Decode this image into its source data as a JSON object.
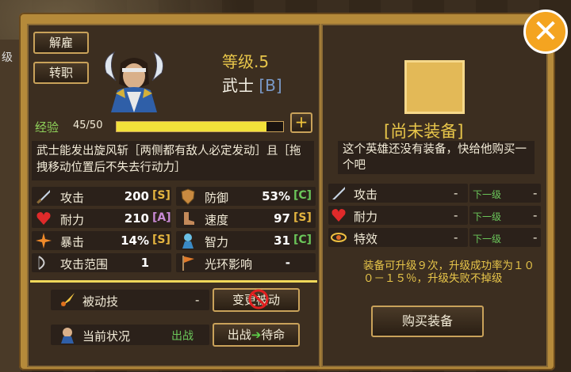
{
  "buttons": {
    "fire": "解雇",
    "transfer": "转职",
    "plus": "+",
    "change_passive": "变更被动",
    "toggle": "出战",
    "toggle_arrow": "➔",
    "toggle_target": "待命",
    "buy": "购买装备",
    "close": "✕"
  },
  "hero": {
    "level": "等级.5",
    "class": "武士",
    "rank": "[B]",
    "exp_label": "经验",
    "exp_value": "45/50",
    "exp_fraction": 0.9,
    "description": "武士能发出旋风斩［两侧都有敌人必定发动］且［拖拽移动位置后不失去行动力］"
  },
  "stats": [
    {
      "label": "攻击",
      "value": "200",
      "grade": "[S]",
      "icon": "sword-icon"
    },
    {
      "label": "防御",
      "value": "53%",
      "grade": "[C]",
      "icon": "shield-icon"
    },
    {
      "label": "耐力",
      "value": "210",
      "grade": "[A]",
      "icon": "heart-icon"
    },
    {
      "label": "速度",
      "value": "97",
      "grade": "[S]",
      "icon": "boot-icon"
    },
    {
      "label": "暴击",
      "value": "14%",
      "grade": "[S]",
      "icon": "burst-icon"
    },
    {
      "label": "智力",
      "value": "31",
      "grade": "[C]",
      "icon": "sage-icon"
    },
    {
      "label": "攻击范围",
      "value": "1",
      "grade": "",
      "icon": "bow-icon"
    },
    {
      "label": "光环影响",
      "value": "-",
      "grade": "",
      "icon": "flag-icon"
    }
  ],
  "passive": {
    "label": "被动技",
    "value": "-"
  },
  "status": {
    "label": "当前状况",
    "value": "出战"
  },
  "equipment": {
    "title": "[尚未装备]",
    "notice": "这个英雄还没有装备，快给他购买一个吧",
    "stats": [
      {
        "label": "攻击",
        "value": "-",
        "next": "下一级",
        "next_value": "-"
      },
      {
        "label": "耐力",
        "value": "-",
        "next": "下一级",
        "next_value": "-"
      },
      {
        "label": "特效",
        "value": "-",
        "next": "下一级",
        "next_value": "-"
      }
    ],
    "upgrade_info": "装备可升级９次，升级成功率为１００－１５％，升级失败不掉级"
  },
  "sidebar": {
    "partial_label": "级"
  },
  "colors": {
    "frame": "#b58a3a",
    "panel": "#3c2e20",
    "gold_text": "#e8c64a",
    "exp_bar": "#f2e23a",
    "green": "#6bc65a"
  }
}
